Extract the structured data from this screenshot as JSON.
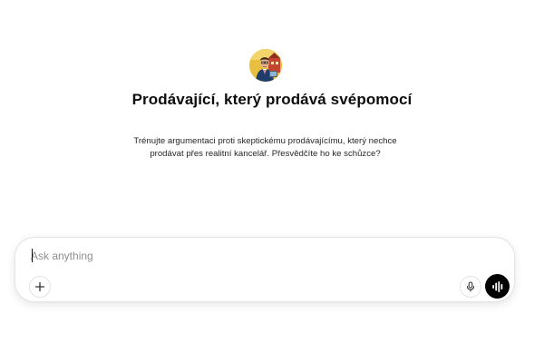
{
  "gpt": {
    "avatar_icon": "salesman-avatar-icon",
    "title": "Prodávající, který prodává svépomocí",
    "description": "Trénujte argumentaci proti skeptickému prodávajícímu, který nechce prodávat přes realitní kancelář. Přesvědčíte ho ke schůzce?"
  },
  "composer": {
    "placeholder": "Ask anything",
    "value": "",
    "icons": {
      "add": "plus-icon",
      "dictate": "microphone-icon",
      "voice": "voice-waveform-icon"
    }
  },
  "colors": {
    "background": "#ffffff",
    "text": "#0d0d0d",
    "placeholder": "#8f8f8f",
    "voice_button": "#000000"
  }
}
